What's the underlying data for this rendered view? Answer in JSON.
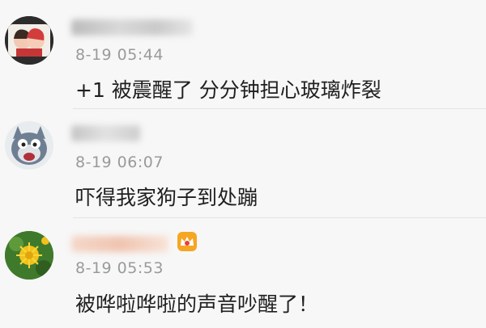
{
  "comments": [
    {
      "timestamp": "8-19 05:44",
      "text": "+1 被震醒了 分分钟担心玻璃炸裂",
      "avatar_icon": "couple-avatar-icon"
    },
    {
      "timestamp": "8-19 06:07",
      "text": "吓得我家狗子到处蹦",
      "avatar_icon": "cartoon-cat-avatar-icon"
    },
    {
      "timestamp": "8-19 05:53",
      "text": "被哗啦哗啦的声音吵醒了！",
      "avatar_icon": "dandelion-avatar-icon"
    }
  ],
  "colors": {
    "background": "#f7f7f7",
    "timestamp": "#9a9a9a",
    "text": "#1f1f1f",
    "badge_orange": "#f5a623",
    "badge_red": "#e8413c"
  },
  "badge_icon": "vip-crown-icon"
}
